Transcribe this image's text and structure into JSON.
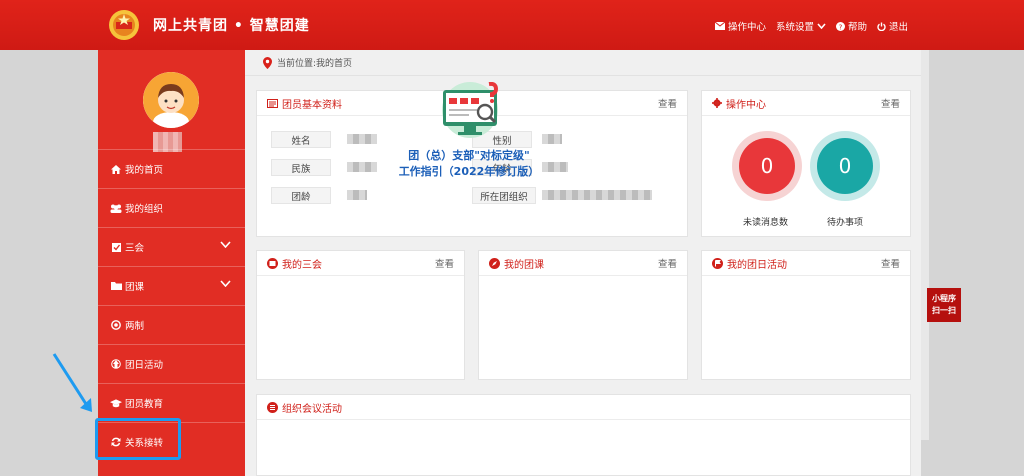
{
  "header": {
    "brand": "网上共青团 • 智慧团建",
    "nav": [
      {
        "label": "操作中心",
        "icon": "envelope-icon"
      },
      {
        "label": "系统设置",
        "icon": "chevron-down-icon"
      },
      {
        "label": "帮助",
        "icon": "help-icon"
      },
      {
        "label": "退出",
        "icon": "power-icon"
      }
    ]
  },
  "sidebar": {
    "items": [
      {
        "label": "我的首页",
        "icon": "home-icon"
      },
      {
        "label": "我的组织",
        "icon": "users-icon"
      },
      {
        "label": "三会",
        "icon": "checkbox-icon"
      },
      {
        "label": "团课",
        "icon": "folder-icon"
      },
      {
        "label": "两制",
        "icon": "target-icon"
      },
      {
        "label": "团日活动",
        "icon": "recycle-icon"
      },
      {
        "label": "团员教育",
        "icon": "graduation-cap-icon"
      },
      {
        "label": "关系接转",
        "icon": "refresh-icon"
      }
    ]
  },
  "breadcrumb": "当前位置:我的首页",
  "profile_panel": {
    "title": "团员基本资料",
    "more": "查看",
    "fields": {
      "name": "姓名",
      "ethnicity": "民族",
      "league_age": "团龄",
      "gender": "性别",
      "age": "年龄",
      "org": "所在团组织"
    }
  },
  "ops_panel": {
    "title": "操作中心",
    "more": "查看",
    "unread_count": "0",
    "unread_label": "未读消息数",
    "todo_count": "0",
    "todo_label": "待办事项"
  },
  "panels": {
    "meetings": {
      "title": "我的三会",
      "more": "查看"
    },
    "lessons": {
      "title": "我的团课",
      "more": "查看"
    },
    "activities": {
      "title": "我的团日活动",
      "more": "查看"
    },
    "org_meetings": {
      "title": "组织会议活动"
    }
  },
  "popup": {
    "line1": "团（总）支部\"对标定级\"",
    "line2": "工作指引（2022年修订版）"
  },
  "mini_program": {
    "line1": "小程序",
    "line2": "扫一扫"
  },
  "colors": {
    "brand_red": "#d9211a",
    "badge_red": "#e8373a",
    "badge_teal": "#1aa7a5",
    "highlight_blue": "#1e9bf0"
  }
}
